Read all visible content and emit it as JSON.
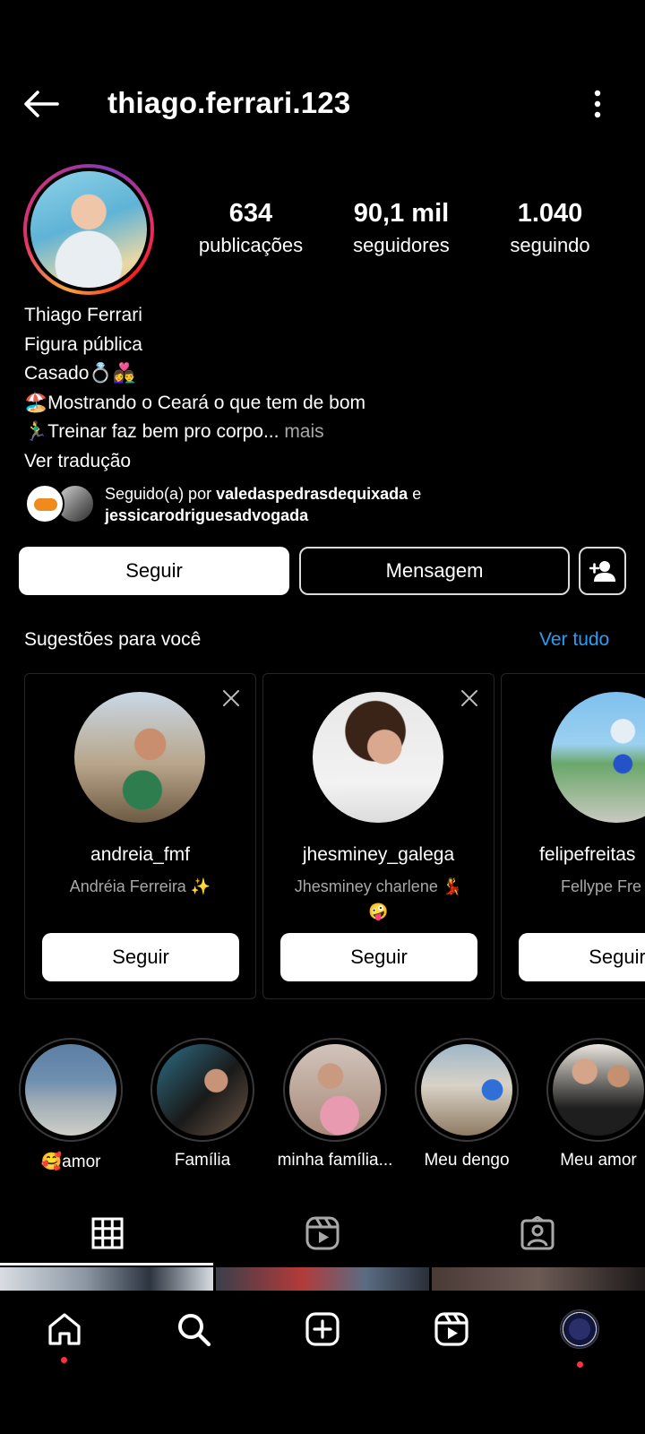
{
  "header": {
    "username": "thiago.ferrari.123"
  },
  "stats": [
    {
      "num": "634",
      "label": "publicações"
    },
    {
      "num": "90,1 mil",
      "label": "seguidores"
    },
    {
      "num": "1.040",
      "label": "seguindo"
    }
  ],
  "bio": {
    "name": "Thiago Ferrari",
    "category": "Figura pública",
    "line1": "Casado💍👩‍❤️‍👨",
    "line2": "🏖️Mostrando o Ceará o que tem de bom",
    "line3": "🏃‍♂️Treinar faz bem pro corpo...",
    "more": " mais",
    "translate": "Ver tradução"
  },
  "followed_by": {
    "prefix": "Seguido(a) por ",
    "user1": "valedaspedrasdequixada",
    "conj": " e ",
    "user2": "jessicarodriguesadvogada"
  },
  "actions": {
    "follow": "Seguir",
    "message": "Mensagem"
  },
  "suggestions": {
    "title": "Sugestões para você",
    "see_all": "Ver tudo",
    "cards": [
      {
        "username": "andreia_fmf",
        "name": "Andréia Ferreira ✨",
        "button": "Seguir"
      },
      {
        "username": "jhesminey_galega",
        "name": "Jhesminey charlene 💃",
        "name2": "🤪",
        "button": "Seguir"
      },
      {
        "username": "felipefreitas",
        "name": "Fellype Fre",
        "button": "Seguir"
      }
    ]
  },
  "highlights": [
    {
      "label": "🥰amor"
    },
    {
      "label": "Família"
    },
    {
      "label": "minha família..."
    },
    {
      "label": "Meu dengo"
    },
    {
      "label": "Meu amor"
    }
  ],
  "tabs": [
    "grid",
    "reels",
    "tagged"
  ],
  "colors": {
    "accent": "#2a9df4",
    "notification": "#ff3040"
  }
}
